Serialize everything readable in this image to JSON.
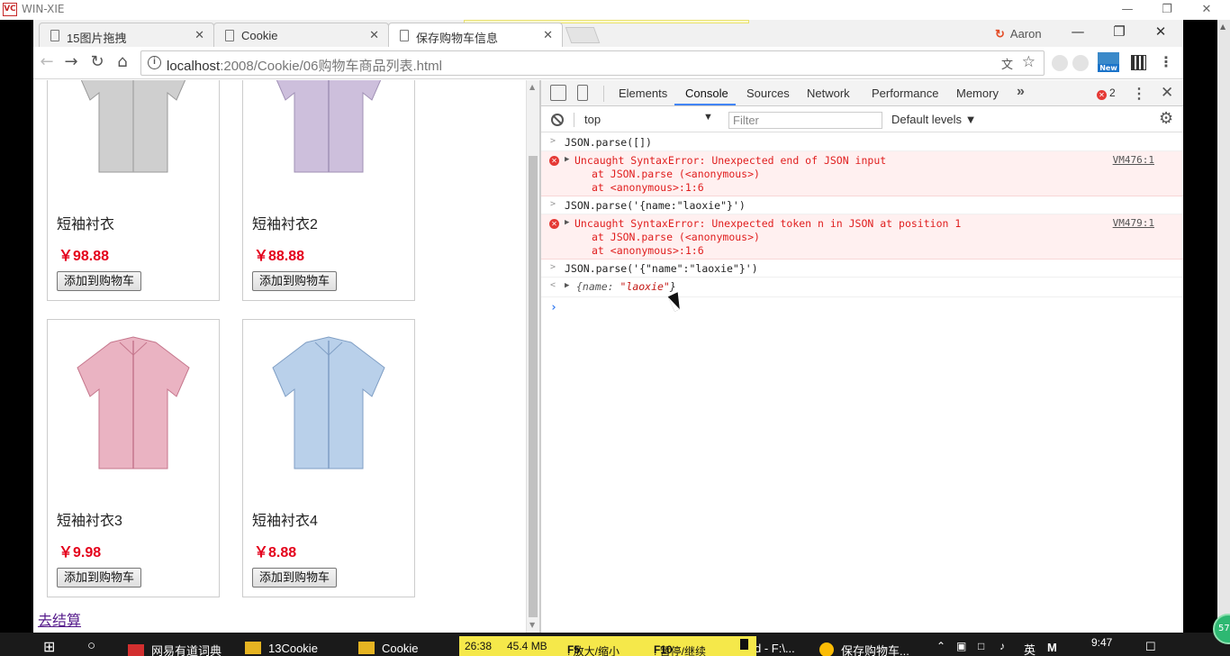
{
  "window": {
    "title": "WIN-XIE",
    "logo": "VC"
  },
  "browser": {
    "tabs": [
      {
        "label": "15图片拖拽",
        "active": false
      },
      {
        "label": "Cookie",
        "active": false
      },
      {
        "label": "保存购物车信息",
        "active": true
      }
    ],
    "profile": "Aaron",
    "url_host": "localhost",
    "url_path": ":2008/Cookie/06购物车商品列表.html",
    "ext_new_label": "New"
  },
  "page": {
    "products": [
      {
        "name": "短袖衬衣",
        "price": "￥98.88",
        "button": "添加到购物车",
        "color": "#cfcfcf"
      },
      {
        "name": "短袖衬衣2",
        "price": "￥88.88",
        "button": "添加到购物车",
        "color": "#cdbfdc"
      },
      {
        "name": "短袖衬衣3",
        "price": "￥9.98",
        "button": "添加到购物车",
        "color": "#eab3c2"
      },
      {
        "name": "短袖衬衣4",
        "price": "￥8.88",
        "button": "添加到购物车",
        "color": "#b9d0ea"
      }
    ],
    "checkout_link": "去结算"
  },
  "devtools": {
    "tabs": [
      "Elements",
      "Console",
      "Sources",
      "Network",
      "Performance",
      "Memory"
    ],
    "active_tab": "Console",
    "error_count": "2",
    "context": "top",
    "filter_placeholder": "Filter",
    "levels": "Default levels",
    "console": {
      "cmd1": "JSON.parse([])",
      "err1": "Uncaught SyntaxError: Unexpected end of JSON input",
      "err1_l2": "at JSON.parse (<anonymous>)",
      "err1_l3": "at <anonymous>:1:6",
      "err1_src": "VM476:1",
      "cmd2": "JSON.parse('{name:\"laoxie\"}')",
      "err2": "Uncaught SyntaxError: Unexpected token n in JSON at position 1",
      "err2_l2": "at JSON.parse (<anonymous>)",
      "err2_l3": "at <anonymous>:1:6",
      "err2_src": "VM479:1",
      "cmd3": "JSON.parse('{\"name\":\"laoxie\"}')",
      "result_key": "{name: ",
      "result_val": "\"laoxie\"",
      "result_end": "}"
    }
  },
  "taskbar": {
    "items": [
      "网易有道词典",
      "13Cookie",
      "Cookie",
      "d - F:\\...",
      "保存购物车..."
    ],
    "time": "9:47",
    "lang": "英",
    "badge": "57"
  },
  "recorder": {
    "elapsed": "26:38",
    "size": "45.4 MB",
    "f5_key": "F5",
    "f5_label": ": 放大/缩小",
    "f10_key": "F10",
    "f10_label": ": 暂停/继续"
  },
  "colors": {
    "price": "#e4001b",
    "devtools_accent": "#4285f4",
    "error_bg": "#fff0f0",
    "taskbar": "#1a1a1a"
  }
}
